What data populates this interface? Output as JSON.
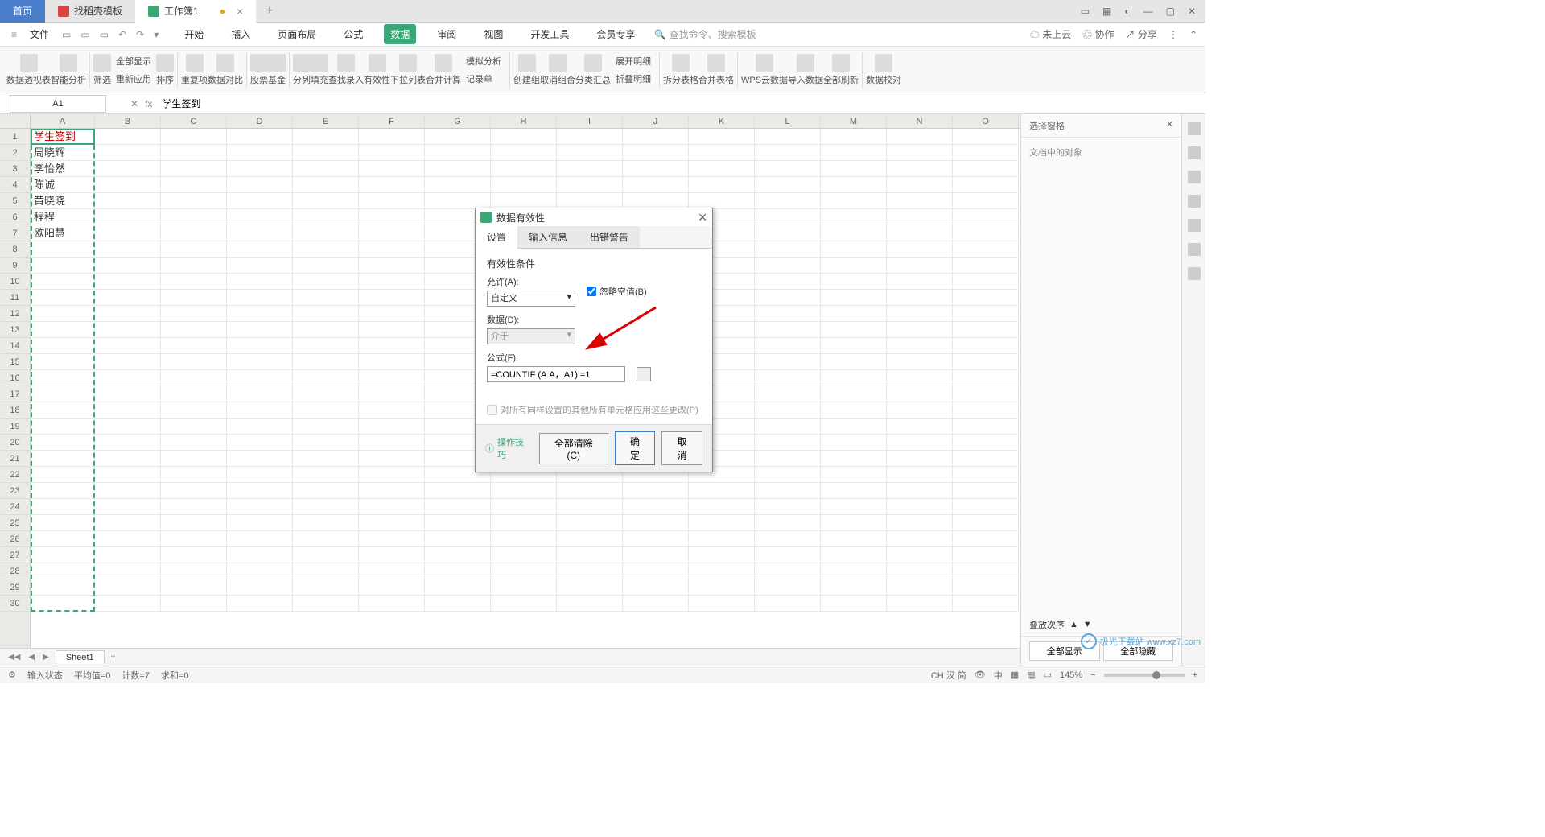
{
  "tabs": {
    "home": "首页",
    "templates": "找稻壳模板",
    "workbook": "工作簿1"
  },
  "menu": {
    "file": "文件",
    "items": [
      "开始",
      "插入",
      "页面布局",
      "公式",
      "数据",
      "审阅",
      "视图",
      "开发工具",
      "会员专享"
    ],
    "active": "数据",
    "search": "查找命令、搜索模板",
    "right": {
      "cloud": "未上云",
      "coop": "协作",
      "share": "分享"
    }
  },
  "ribbon": [
    "数据透视表",
    "智能分析",
    "筛选",
    "全部显示",
    "重新应用",
    "排序",
    "重复项",
    "数据对比",
    "股票",
    "基金",
    "分列",
    "填充",
    "查找录入",
    "有效性",
    "下拉列表",
    "合并计算",
    "模拟分析",
    "记录单",
    "创建组",
    "取消组合",
    "分类汇总",
    "展开明细",
    "折叠明细",
    "拆分表格",
    "合并表格",
    "WPS云数据",
    "导入数据",
    "全部刷新",
    "数据校对"
  ],
  "formula_bar": {
    "name_box": "A1",
    "fx": "fx",
    "value": "学生签到"
  },
  "columns": [
    "A",
    "B",
    "C",
    "D",
    "E",
    "F",
    "G",
    "H",
    "I",
    "J",
    "K",
    "L",
    "M",
    "N",
    "O"
  ],
  "col_a": [
    "学生签到",
    "周晓辉",
    "李怡然",
    "陈诚",
    "黄晓晓",
    "程程",
    "欧阳慧"
  ],
  "side": {
    "title": "选择窗格",
    "body": "文档中的对象",
    "order": "叠放次序",
    "show_all": "全部显示",
    "hide_all": "全部隐藏"
  },
  "sheet": {
    "name": "Sheet1"
  },
  "status": {
    "state": "输入状态",
    "avg": "平均值=0",
    "count": "计数=7",
    "sum": "求和=0",
    "ime": "CH 汉 简",
    "zoom": "145%"
  },
  "dialog": {
    "title": "数据有效性",
    "tabs": [
      "设置",
      "输入信息",
      "出错警告"
    ],
    "section": "有效性条件",
    "allow_label": "允许(A):",
    "allow_value": "自定义",
    "ignore_blank": "忽略空值(B)",
    "data_label": "数据(D):",
    "data_value": "介于",
    "formula_label": "公式(F):",
    "formula_value": "=COUNTIF (A:A，A1) =1",
    "share_label": "对所有同样设置的其他所有单元格应用这些更改(P)",
    "tip": "操作技巧",
    "clear": "全部清除(C)",
    "ok": "确定",
    "cancel": "取消"
  },
  "watermark": "极光下载站 www.xz7.com"
}
